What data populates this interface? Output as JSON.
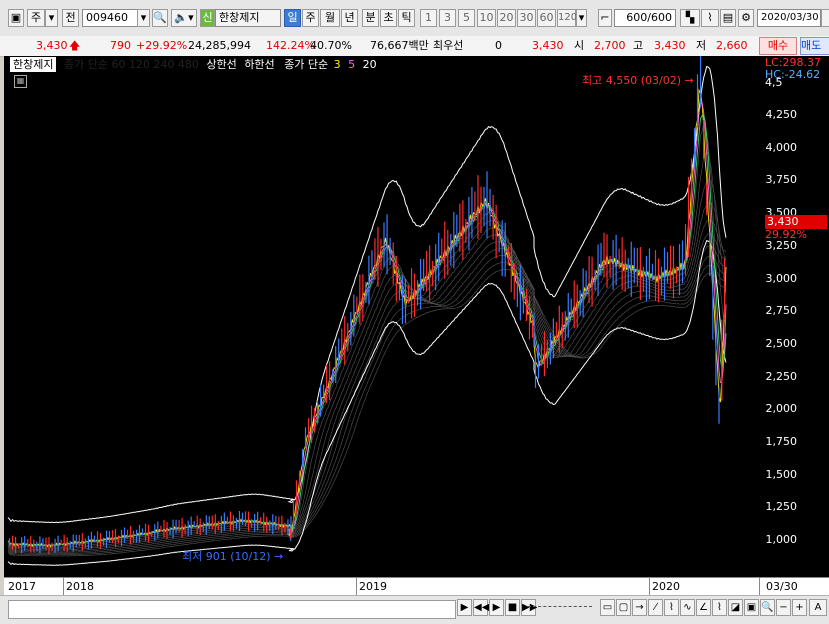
{
  "toolbar": {
    "market_type": "주",
    "market_all": "전",
    "stock_code": "009460",
    "credit_badge": "신",
    "stock_name": "한창제지",
    "period_buttons": [
      "일",
      "주",
      "월",
      "년"
    ],
    "period_selected": "일",
    "minute_buttons": [
      "분",
      "초",
      "틱"
    ],
    "interval_buttons": [
      "1",
      "3",
      "5",
      "10",
      "20",
      "30",
      "60",
      "120"
    ],
    "count_value": "600",
    "count_total": "/600",
    "date_value": "2020/03/30",
    "partial_label": "매"
  },
  "quote": {
    "price": "3,430",
    "change": "790",
    "change_pct": "+29.92%",
    "volume": "24,285,994",
    "volume_ratio": "142.24%",
    "turnover": "40.70%",
    "amount": "76,667백만",
    "priority_label": "최우선",
    "priority_value": "0",
    "current": "3,430",
    "open_label": "시",
    "open": "2,700",
    "high_label": "고",
    "high": "3,430",
    "low_label": "저",
    "low": "2,660",
    "buy_button": "매수",
    "sell_partial": "매도"
  },
  "legend": {
    "name": "한창제지",
    "ma_price": "종가 단순 60 120 240 480",
    "upper": "상한선",
    "lower": "하한선",
    "ma_price2": "종가 단순",
    "ma3": "3",
    "ma5": "5",
    "ma20": "20"
  },
  "annotations": {
    "high_note": "최고 4,550 (03/02) →",
    "low_note": "최저 901 (10/12) →",
    "lc": "LC:298.37",
    "hc": "HC:-24.62",
    "price_tag": "3,430",
    "pct_tag": "29.92%"
  },
  "y_axis": {
    "ticks": [
      "4,250",
      "4,000",
      "3,750",
      "3,500",
      "3,250",
      "3,000",
      "2,750",
      "2,500",
      "2,250",
      "2,000",
      "1,750",
      "1,500",
      "1,250",
      "1,000"
    ],
    "top_partial": "4,5"
  },
  "x_axis": {
    "labels": [
      "2017",
      "2018",
      "2019",
      "2020"
    ],
    "last_date": "03/30"
  },
  "colors": {
    "up": "#ff2a2a",
    "down": "#3a7cff",
    "ma3": "#ffee00",
    "ma5": "#ff66cc",
    "ma20": "#33dd66",
    "envelope": "#ffffff"
  },
  "chart_data": {
    "type": "line",
    "title": "",
    "xlabel": "",
    "ylabel": "",
    "ylim": [
      700,
      4600
    ],
    "x": [
      "2017-01",
      "2017-04",
      "2017-07",
      "2017-10",
      "2018-01",
      "2018-04",
      "2018-07",
      "2018-10",
      "2018-11",
      "2019-01",
      "2019-03",
      "2019-05",
      "2019-07",
      "2019-09",
      "2019-11",
      "2020-01",
      "2020-02",
      "2020-03-02",
      "2020-03-16",
      "2020-03-30"
    ],
    "series": [
      {
        "name": "",
        "values": [
          970,
          960,
          1000,
          1050,
          1080,
          1150,
          1100,
          1000,
          1750,
          3300,
          2800,
          3600,
          2600,
          2300,
          3150,
          3000,
          3100,
          4550,
          1900,
          3430
        ]
      }
    ]
  }
}
